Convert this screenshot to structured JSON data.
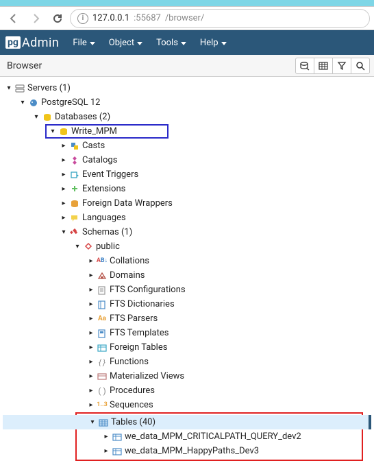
{
  "url": {
    "host": "127.0.0.1",
    "port": ":55687",
    "path": "/browser/"
  },
  "menu": {
    "file": "File",
    "object": "Object",
    "tools": "Tools",
    "help": "Help"
  },
  "panel_title": "Browser",
  "tree": {
    "servers": "Servers (1)",
    "pg": "PostgreSQL 12",
    "databases": "Databases (2)",
    "db": "Write_MPM",
    "casts": "Casts",
    "catalogs": "Catalogs",
    "event_triggers": "Event Triggers",
    "extensions": "Extensions",
    "fdw": "Foreign Data Wrappers",
    "languages": "Languages",
    "schemas": "Schemas (1)",
    "public": "public",
    "collations": "Collations",
    "domains": "Domains",
    "fts_conf": "FTS Configurations",
    "fts_dict": "FTS Dictionaries",
    "fts_parsers": "FTS Parsers",
    "fts_templates": "FTS Templates",
    "foreign_tables": "Foreign Tables",
    "functions": "Functions",
    "mat_views": "Materialized Views",
    "procedures": "Procedures",
    "sequences": "Sequences",
    "tables": "Tables (40)",
    "t1": "we_data_MPM_CRITICALPATH_QUERY_dev2",
    "t2": "we_data_MPM_HappyPaths_Dev3"
  }
}
